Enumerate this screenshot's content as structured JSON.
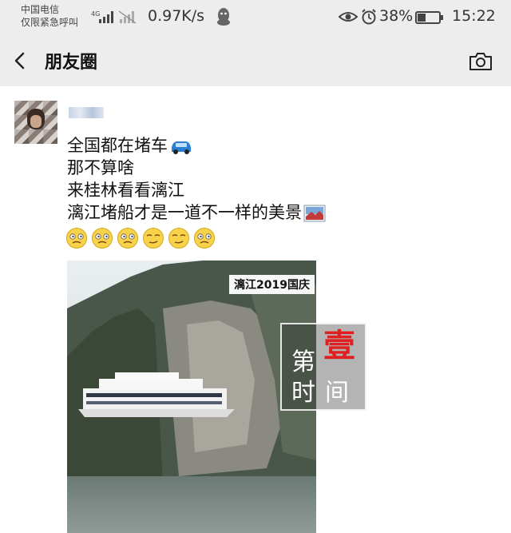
{
  "status_bar": {
    "carrier_line1": "中国电信",
    "carrier_line2": "仅限紧急呼叫",
    "network": "4G",
    "speed": "0.97K/s",
    "battery_percent": "38%",
    "time": "15:22"
  },
  "title_bar": {
    "title": "朋友圈"
  },
  "post": {
    "lines": [
      "全国都在堵车",
      "那不算啥",
      "来桂林看看漓江",
      "漓江堵船才是一道不一样的美景"
    ],
    "emoji_count": 6,
    "video": {
      "caption": "漓江2019国庆"
    },
    "watermark": {
      "chars": [
        "第",
        "壹",
        "时",
        "间"
      ]
    }
  },
  "colors": {
    "bar_background": "#ededed",
    "watermark_red": "#e02020"
  }
}
